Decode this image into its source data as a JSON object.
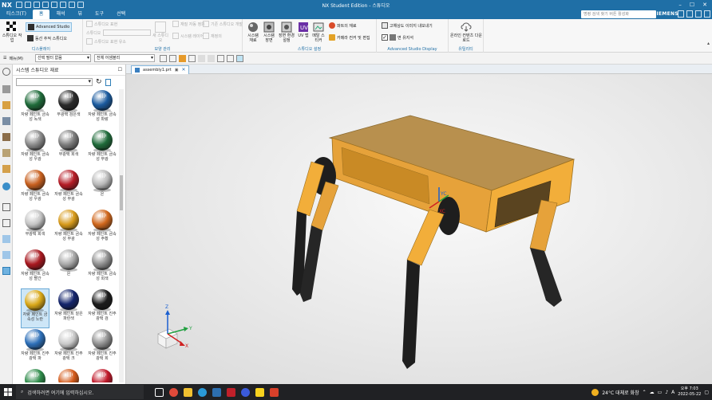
{
  "app": {
    "logo": "NX",
    "window_title": "NX Student Edition - 스튜디오",
    "brand": "SIEMENS"
  },
  "menu": {
    "items": [
      "티스크(T)",
      "홈",
      "해석",
      "뷰",
      "도구",
      "선택"
    ],
    "active_index": 1,
    "command_search_placeholder": "명령 검색 찾기 버튼 활성화"
  },
  "ribbon": {
    "display_group": {
      "label": "디스플레이",
      "studio_task_label": "스튜디오 작업",
      "advanced_studio_label": "Advanced Studio",
      "studio_to_display_label": "동선 추적 스튜디오"
    },
    "appearance_group": {
      "label": "모양 관리",
      "buttons": [
        "스튜디오 표현",
        "스튜디오",
        "스튜디오 표현 유소",
        "새 스튜디오",
        "재질 자동 정보",
        "기존 스튜디오 개발",
        "시스템 레이어",
        "재정의"
      ]
    },
    "studio_settings_group": {
      "label": "스튜디오 설정",
      "buttons": [
        "시스템 재료",
        "시스템 장면",
        "장면 환경설정",
        "UV 맵",
        "메탈 스티커"
      ],
      "small": [
        "파트의 재료",
        "카메라 컨커 및 편집"
      ]
    },
    "advanced_display_group": {
      "label": "Advanced Studio Display",
      "high_quality_label": "고해상도 이미지 내보내기",
      "ray_trace_label": "면 유지석"
    },
    "utility_group": {
      "label": "유틸리티",
      "online_label": "온라인 컨텐츠 다운로드"
    }
  },
  "topbar": {
    "menu_label": "메뉴(M)",
    "filter_value": "선택 필터 없음",
    "scope_value": "전체 어셈블리"
  },
  "palette": {
    "title": "시스템 스튜디오 재료",
    "items": [
      {
        "label": "자량 페인트 금속성 녹색",
        "color": "#1f6b3a"
      },
      {
        "label": "무광택 검은색",
        "color": "#2a2a2a"
      },
      {
        "label": "자량 페인트 금속성 파랑",
        "color": "#1a5a9e"
      },
      {
        "label": "자량 페인트 금속성 우광",
        "color": "#8a8a8a"
      },
      {
        "label": "무광택 회색",
        "color": "#7b7b7b"
      },
      {
        "label": "자량 페인트 금속성 무광",
        "color": "#1f6b3a"
      },
      {
        "label": "자량 페인트 금속성 우광",
        "color": "#c8601f"
      },
      {
        "label": "자량 페인트 금속성 무광",
        "color": "#b51c26"
      },
      {
        "label": "은",
        "color": "#b9b9b9"
      },
      {
        "label": "무광택 회색",
        "color": "#c4c4c4"
      },
      {
        "label": "자량 페인트 금속성 무광",
        "color": "#d79a1a"
      },
      {
        "label": "자량 페인트 금속성 주황",
        "color": "#d0671c"
      },
      {
        "label": "자량 페인트 금속성 빨간",
        "color": "#a8181f"
      },
      {
        "label": "은",
        "color": "#a8a8a8"
      },
      {
        "label": "자량 페인트 금속성 회색",
        "color": "#8e8e8e"
      },
      {
        "label": "자량 페인트 금속성 노란",
        "color": "#d9a818"
      },
      {
        "label": "자량 페인트 짙은 파란색",
        "color": "#13246b"
      },
      {
        "label": "자량 페인트 진주 광택 검",
        "color": "#1c1c1c"
      },
      {
        "label": "자량 페인트 진주 광택 파",
        "color": "#2d6fb8"
      },
      {
        "label": "자량 페인트 진주 광택 크",
        "color": "#c9c9c9"
      },
      {
        "label": "자량 페인트 진주 광택 회",
        "color": "#8f8f8f"
      },
      {
        "label": "",
        "color": "#2e8b4a"
      },
      {
        "label": "",
        "color": "#d35a1a"
      },
      {
        "label": "",
        "color": "#c0192a"
      }
    ],
    "selected_index": 15
  },
  "document": {
    "tab_label": "assembly1.prt"
  },
  "viewport": {
    "body_color": "#f2ae3a",
    "leg_color": "#1e1e1e",
    "triad_labels": {
      "x": "X",
      "y": "Y",
      "z": "Z"
    },
    "csys_labels": {
      "xc": "XC",
      "yc": "YC"
    }
  },
  "taskbar": {
    "search_placeholder": "검색하려면 여기에 입력하십시오.",
    "weather": "24°C 대체로 화창",
    "time": "오후 7:03",
    "date": "2022-05-22",
    "ime": "A"
  }
}
